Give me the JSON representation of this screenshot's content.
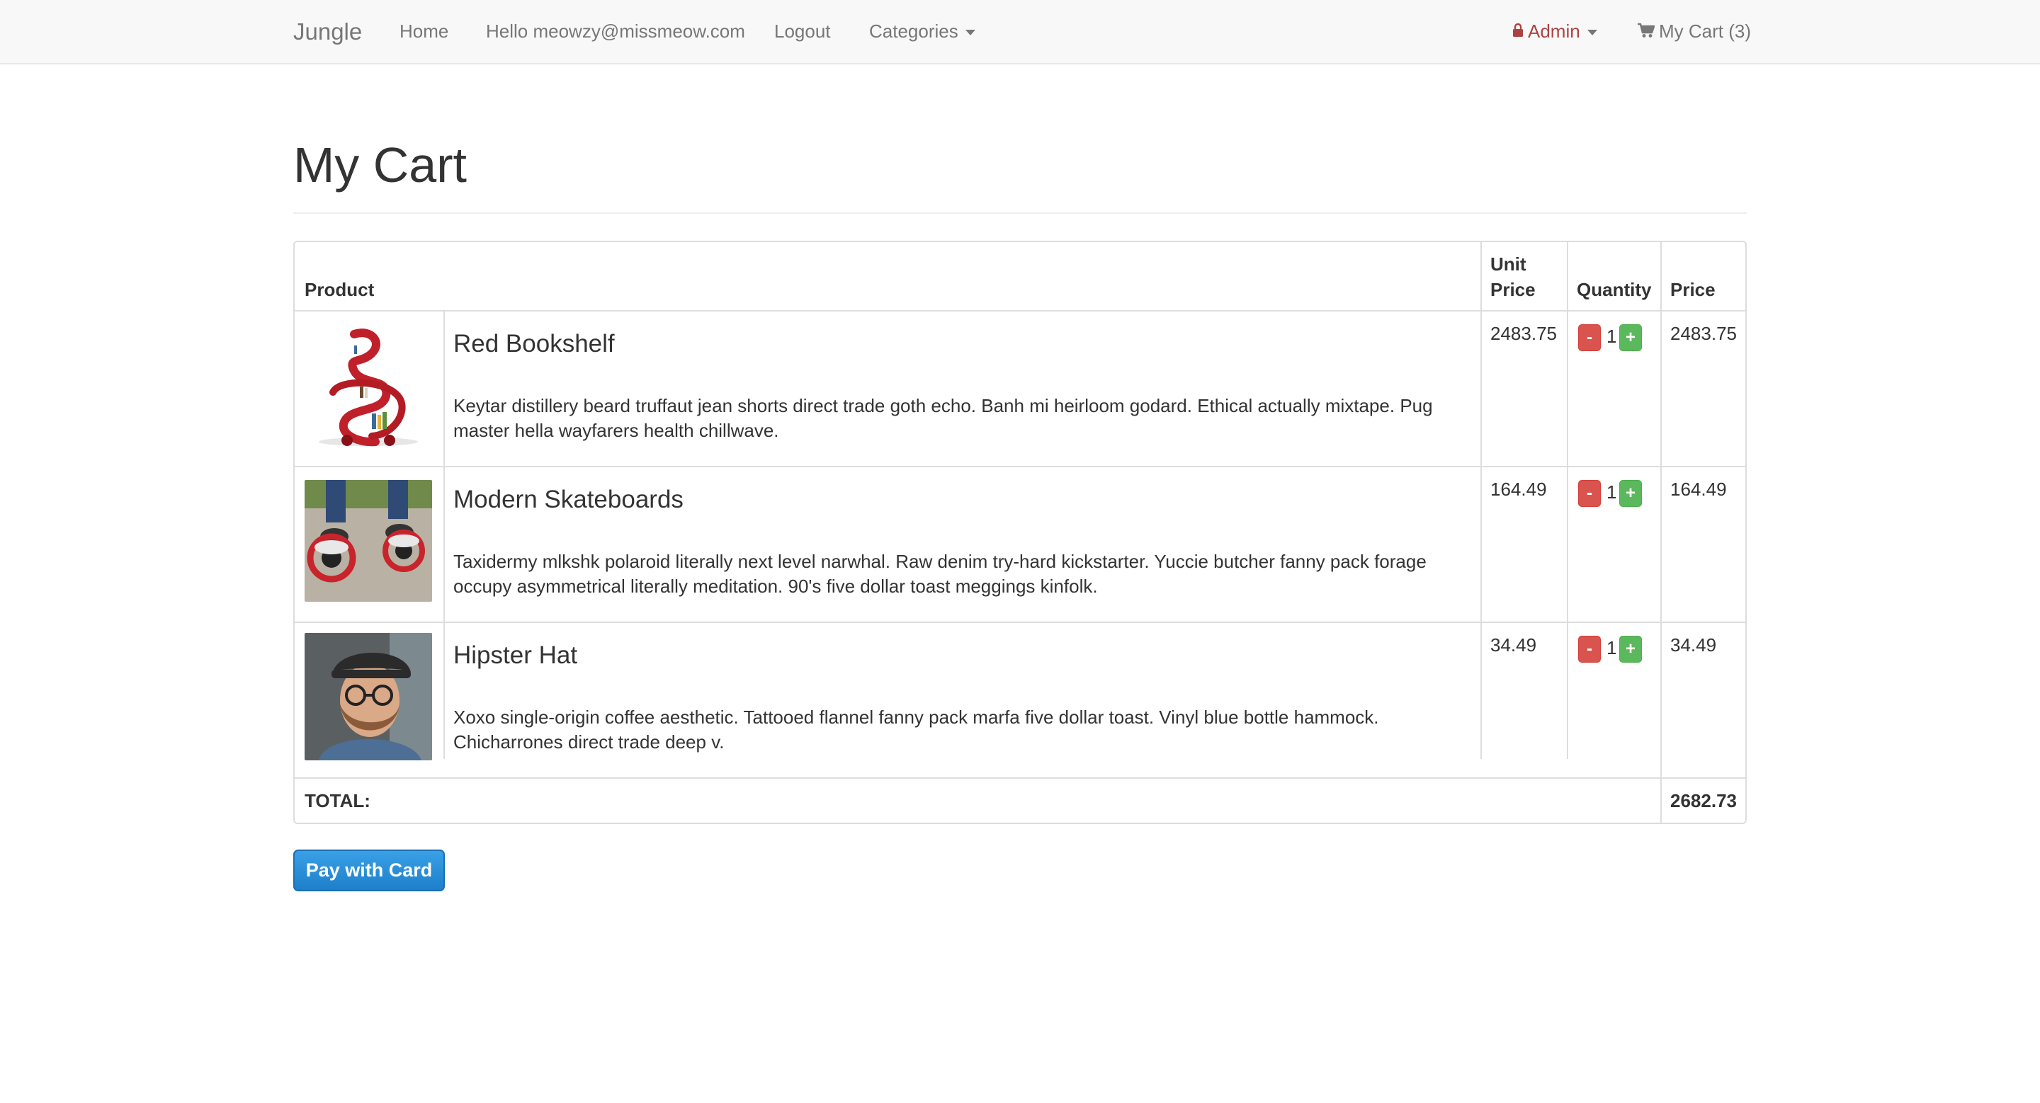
{
  "navbar": {
    "brand": "Jungle",
    "home": "Home",
    "greeting": "Hello meowzy@missmeow.com",
    "logout": "Logout",
    "categories": "Categories",
    "admin": "Admin",
    "cart": "My Cart (3)"
  },
  "page": {
    "title": "My Cart"
  },
  "table": {
    "headers": {
      "product": "Product",
      "unit_price_line1": "Unit",
      "unit_price_line2": "Price",
      "quantity": "Quantity",
      "price": "Price"
    },
    "rows": [
      {
        "name": "Red Bookshelf",
        "description": "Keytar distillery beard truffaut jean shorts direct trade goth echo. Banh mi heirloom godard. Ethical actually mixtape. Pug master hella wayfarers health chillwave.",
        "unit_price": "2483.75",
        "quantity": "1",
        "price": "2483.75",
        "minus": "-",
        "plus": "+"
      },
      {
        "name": "Modern Skateboards",
        "description": "Taxidermy mlkshk polaroid literally next level narwhal. Raw denim try-hard kickstarter. Yuccie butcher fanny pack forage occupy asymmetrical literally meditation. 90's five dollar toast meggings kinfolk.",
        "unit_price": "164.49",
        "quantity": "1",
        "price": "164.49",
        "minus": "-",
        "plus": "+"
      },
      {
        "name": "Hipster Hat",
        "description": "Xoxo single-origin coffee aesthetic. Tattooed flannel fanny pack marfa five dollar toast. Vinyl blue bottle hammock. Chicharrones direct trade deep v.",
        "unit_price": "34.49",
        "quantity": "1",
        "price": "34.49",
        "minus": "-",
        "plus": "+"
      }
    ],
    "total_label": "TOTAL:",
    "total_value": "2682.73"
  },
  "actions": {
    "pay_label": "Pay with Card"
  },
  "colors": {
    "navbar_bg": "#f8f8f8",
    "admin": "#a94442",
    "minus_btn": "#d9534f",
    "plus_btn": "#5cb85c",
    "pay_btn": "#2a8fd8"
  },
  "icons": {
    "admin": "lock-icon",
    "cart": "shopping-cart-icon",
    "dropdown": "caret-down-icon"
  }
}
